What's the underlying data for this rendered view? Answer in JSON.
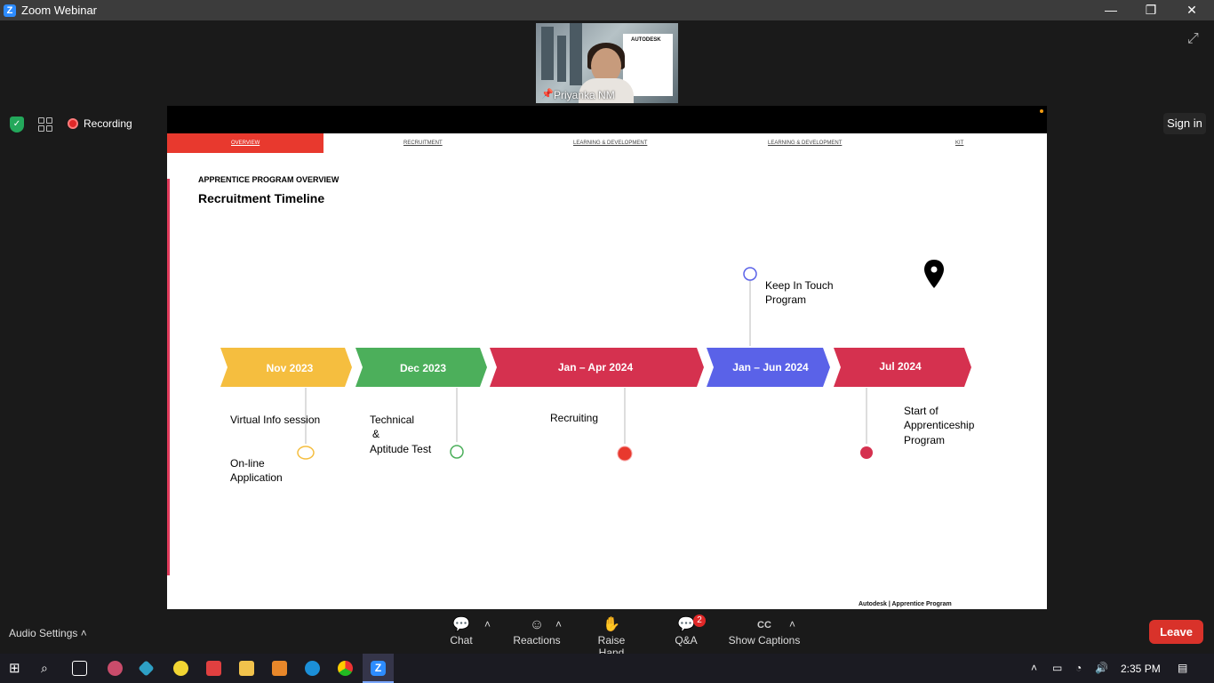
{
  "window": {
    "title": "Zoom Webinar",
    "minimize": "—",
    "maximize": "❐",
    "close": "✕"
  },
  "video": {
    "name": "Priyanka NM",
    "logo_text": "AUTODESK"
  },
  "meeting": {
    "recording_label": "Recording",
    "sign_in": "Sign in"
  },
  "slide": {
    "nav": [
      "OVERVIEW",
      "RECRUITMENT",
      "LEARNING & DEVELOPMENT",
      "LEARNING & DEVELOPMENT",
      "KIT"
    ],
    "kicker": "APPRENTICE PROGRAM OVERVIEW",
    "title": "Recruitment Timeline",
    "phases": [
      {
        "label": "Nov 2023",
        "color": "#f5be3f"
      },
      {
        "label": "Dec 2023",
        "color": "#4caf5b"
      },
      {
        "label": "Jan – Apr 2024",
        "color": "#d5314f"
      },
      {
        "label": "Jan – Jun 2024",
        "color": "#5a62e8"
      },
      {
        "label": "Jul 2024",
        "color": "#d5314f"
      }
    ],
    "milestones": {
      "virtual_info": "Virtual Info session",
      "online_app": "On-line Application",
      "technical": "Technical",
      "amp": "&",
      "aptitude": "Aptitude Test",
      "recruiting": "Recruiting",
      "keep_in_touch_1": "Keep In Touch",
      "keep_in_touch_2": "Program",
      "start_1": "Start of",
      "start_2": "Apprenticeship",
      "start_3": "Program"
    },
    "footer": "Autodesk  |  Apprentice Program"
  },
  "toolbar": {
    "audio_settings": "Audio Settings",
    "chat": "Chat",
    "reactions": "Reactions",
    "raise_hand": "Raise Hand",
    "qa": "Q&A",
    "qa_badge": "2",
    "captions": "Show Captions",
    "captions_icon": "CC",
    "leave": "Leave"
  },
  "taskbar": {
    "time": "2:35 PM"
  }
}
